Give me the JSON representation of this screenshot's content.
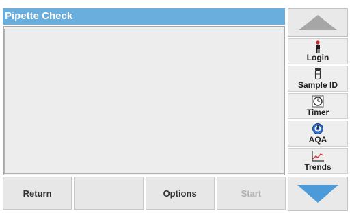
{
  "window": {
    "title": "Pipette Check"
  },
  "bottom_bar": {
    "return_label": "Return",
    "options_label": "Options",
    "start_label": "Start"
  },
  "sidebar": {
    "items": [
      {
        "label": "Login",
        "icon": "person-icon"
      },
      {
        "label": "Sample ID",
        "icon": "sample-vial-icon"
      },
      {
        "label": "Timer",
        "icon": "timer-icon"
      },
      {
        "label": "AQA",
        "icon": "aqa-icon"
      },
      {
        "label": "Trends",
        "icon": "trends-chart-icon"
      }
    ]
  },
  "colors": {
    "title_bar": "#6aaedd",
    "arrow": "#4c9bd8",
    "disabled_text": "#b0b0b0"
  }
}
